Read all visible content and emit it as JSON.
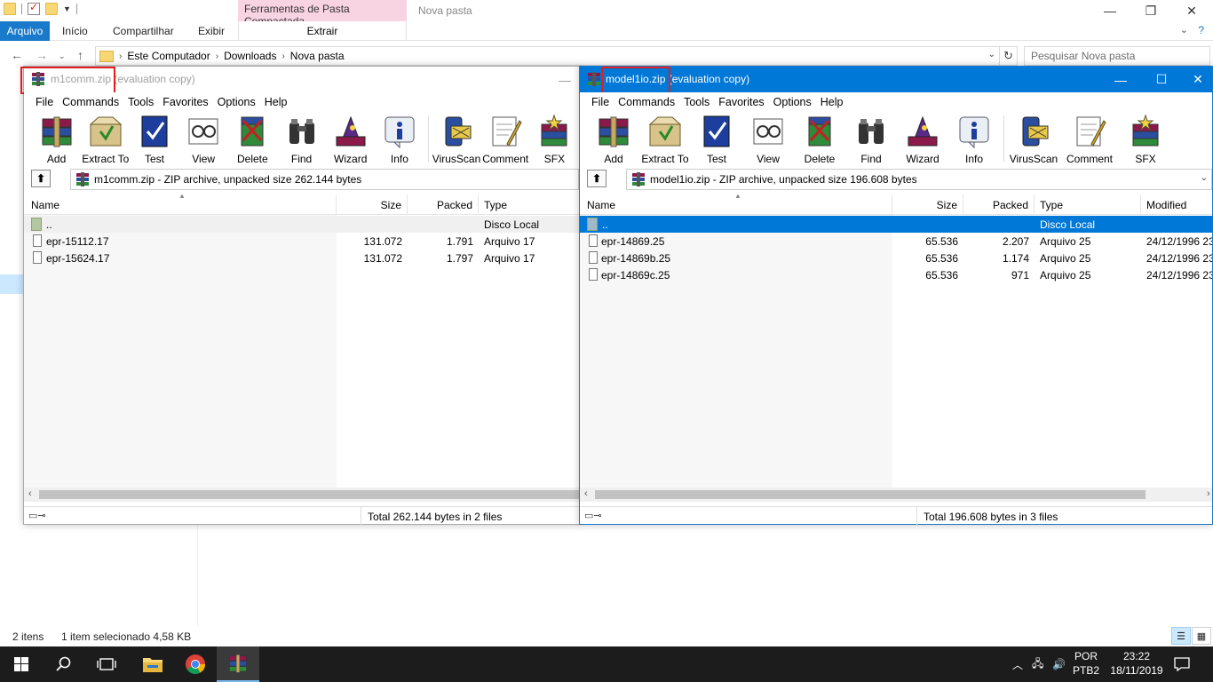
{
  "explorer": {
    "title": "Nova pasta",
    "context_tab_header": "Ferramentas de Pasta Compactada",
    "tabs": [
      "Arquivo",
      "Início",
      "Compartilhar",
      "Exibir"
    ],
    "context_tab": "Extrair",
    "breadcrumb": [
      "Este Computador",
      "Downloads",
      "Nova pasta"
    ],
    "search_placeholder": "Pesquisar Nova pasta",
    "status": {
      "items": "2 itens",
      "selected": "1 item selecionado  4,58 KB"
    }
  },
  "rar_menu": [
    "File",
    "Commands",
    "Tools",
    "Favorites",
    "Options",
    "Help"
  ],
  "rar_left": {
    "title_name": "m1comm.zip",
    "title_suffix": " (evaluation copy)",
    "toolbar": [
      "Add",
      "Extract To",
      "Test",
      "View",
      "Delete",
      "Find",
      "Wizard",
      "Info",
      "VirusScan",
      "Comment",
      "SFX"
    ],
    "path": "m1comm.zip - ZIP archive, unpacked size 262.144 bytes",
    "columns": {
      "name": "Name",
      "size": "Size",
      "packed": "Packed",
      "type": "Type"
    },
    "up_row": {
      "name": "..",
      "type": "Disco Local"
    },
    "files": [
      {
        "name": "epr-15112.17",
        "size": "131.072",
        "packed": "1.791",
        "type": "Arquivo 17"
      },
      {
        "name": "epr-15624.17",
        "size": "131.072",
        "packed": "1.797",
        "type": "Arquivo 17"
      }
    ],
    "status": "Total 262.144 bytes in 2 files"
  },
  "rar_right": {
    "title_name": "model1io.zip",
    "title_suffix": " (evaluation copy)",
    "toolbar": [
      "Add",
      "Extract To",
      "Test",
      "View",
      "Delete",
      "Find",
      "Wizard",
      "Info",
      "VirusScan",
      "Comment",
      "SFX"
    ],
    "path": "model1io.zip - ZIP archive, unpacked size 196.608 bytes",
    "columns": {
      "name": "Name",
      "size": "Size",
      "packed": "Packed",
      "type": "Type",
      "modified": "Modified"
    },
    "up_row": {
      "name": "..",
      "type": "Disco Local"
    },
    "files": [
      {
        "name": "epr-14869.25",
        "size": "65.536",
        "packed": "2.207",
        "type": "Arquivo 25",
        "modified": "24/12/1996 23:"
      },
      {
        "name": "epr-14869b.25",
        "size": "65.536",
        "packed": "1.174",
        "type": "Arquivo 25",
        "modified": "24/12/1996 23:"
      },
      {
        "name": "epr-14869c.25",
        "size": "65.536",
        "packed": "971",
        "type": "Arquivo 25",
        "modified": "24/12/1996 23:"
      }
    ],
    "status": "Total 196.608 bytes in 3 files"
  },
  "taskbar": {
    "lang_top": "POR",
    "lang_bottom": "PTB2",
    "time": "23:22",
    "date": "18/11/2019"
  },
  "colors": {
    "accent": "#0078d7",
    "highlight_box": "#e02020",
    "context_tab": "#f8d3e2"
  }
}
